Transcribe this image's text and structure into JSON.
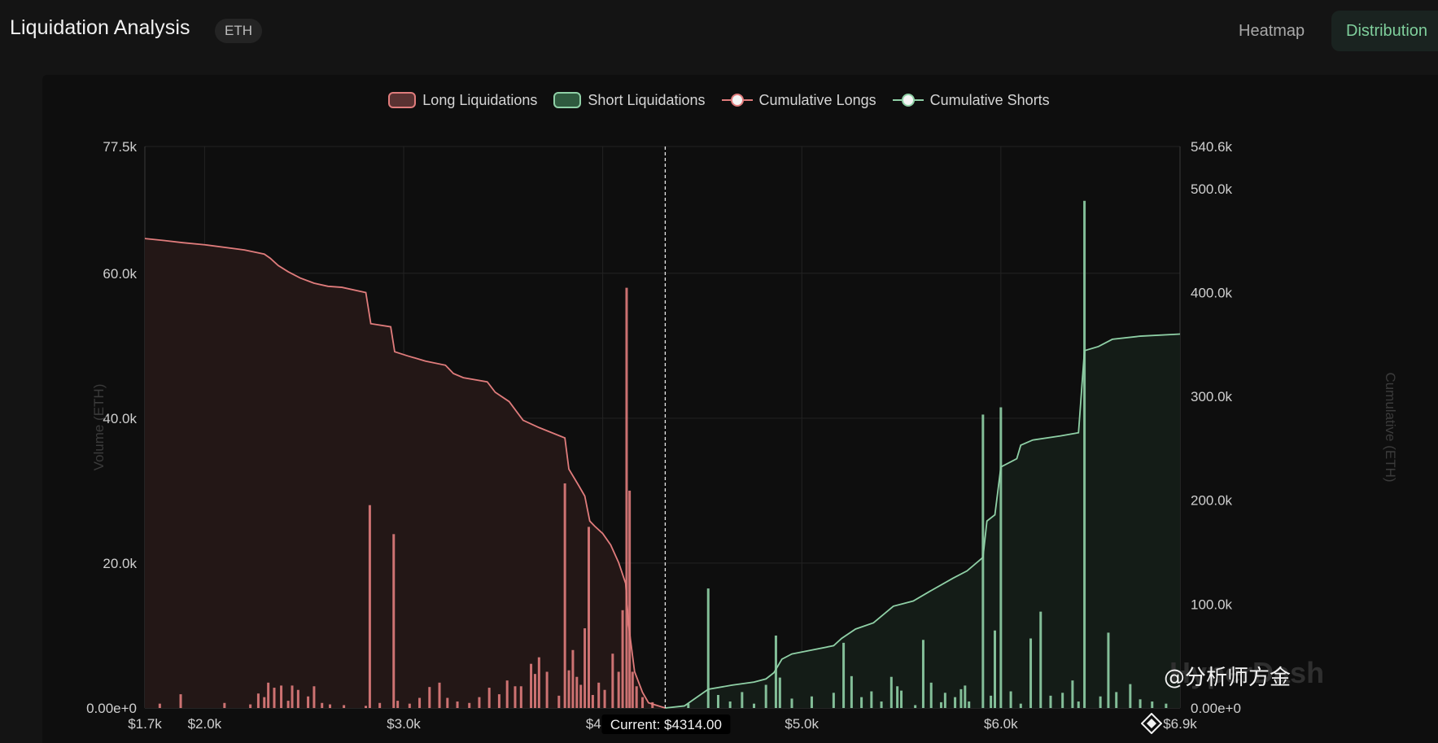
{
  "header": {
    "title": "Liquidation Analysis",
    "asset_badge": "ETH",
    "tabs": [
      {
        "label": "Heatmap",
        "active": false
      },
      {
        "label": "Distribution",
        "active": true
      }
    ]
  },
  "legend": {
    "long_liquidations": "Long Liquidations",
    "short_liquidations": "Short Liquidations",
    "cumulative_longs": "Cumulative Longs",
    "cumulative_shorts": "Cumulative Shorts"
  },
  "colors": {
    "long": "#e07c7c",
    "short": "#8fd0a6",
    "long_fill": "#231716",
    "short_fill": "#141c17",
    "accent": "#7fcf9c"
  },
  "current_price_label": "Current: $4314.00",
  "watermark": "HyperDash",
  "overlay_caption": "@分析师方金",
  "chart_data": {
    "type": "bar",
    "xlabel": "",
    "ylabel": "Volume (ETH)",
    "y2label": "Cumulative (ETH)",
    "xlim": [
      1700,
      6900
    ],
    "ylim": [
      0,
      77500
    ],
    "y2lim": [
      0,
      540600
    ],
    "current_price": 4314,
    "x_tick_labels": [
      {
        "x": 1700,
        "label": "$1.7k"
      },
      {
        "x": 2000,
        "label": "$2.0k"
      },
      {
        "x": 3000,
        "label": "$3.0k"
      },
      {
        "x": 4000,
        "label": "$4.0k"
      },
      {
        "x": 5000,
        "label": "$5.0k"
      },
      {
        "x": 6000,
        "label": "$6.0k"
      },
      {
        "x": 6900,
        "label": "$6.9k"
      }
    ],
    "y_tick_labels": [
      {
        "y": 0,
        "label": "0.00e+0"
      },
      {
        "y": 20000,
        "label": "20.0k"
      },
      {
        "y": 40000,
        "label": "40.0k"
      },
      {
        "y": 60000,
        "label": "60.0k"
      },
      {
        "y": 77500,
        "label": "77.5k"
      }
    ],
    "y2_tick_labels": [
      {
        "y": 0,
        "label": "0.00e+0"
      },
      {
        "y": 100000,
        "label": "100.0k"
      },
      {
        "y": 200000,
        "label": "200.0k"
      },
      {
        "y": 300000,
        "label": "300.0k"
      },
      {
        "y": 400000,
        "label": "400.0k"
      },
      {
        "y": 500000,
        "label": "500.0k"
      },
      {
        "y": 540600,
        "label": "540.6k"
      }
    ],
    "series": [
      {
        "name": "Long Liquidations",
        "kind": "bars",
        "points": [
          [
            1775,
            600
          ],
          [
            1880,
            1900
          ],
          [
            2100,
            700
          ],
          [
            2230,
            500
          ],
          [
            2270,
            2000
          ],
          [
            2300,
            1500
          ],
          [
            2320,
            3500
          ],
          [
            2350,
            2800
          ],
          [
            2385,
            3100
          ],
          [
            2420,
            1000
          ],
          [
            2440,
            3100
          ],
          [
            2470,
            2500
          ],
          [
            2520,
            1600
          ],
          [
            2550,
            3000
          ],
          [
            2590,
            700
          ],
          [
            2630,
            500
          ],
          [
            2700,
            400
          ],
          [
            2810,
            300
          ],
          [
            2830,
            28000
          ],
          [
            2880,
            700
          ],
          [
            2950,
            24000
          ],
          [
            2970,
            1000
          ],
          [
            3030,
            600
          ],
          [
            3080,
            1400
          ],
          [
            3130,
            2900
          ],
          [
            3180,
            3500
          ],
          [
            3220,
            1400
          ],
          [
            3270,
            900
          ],
          [
            3330,
            700
          ],
          [
            3380,
            1500
          ],
          [
            3430,
            2800
          ],
          [
            3480,
            1900
          ],
          [
            3520,
            3800
          ],
          [
            3560,
            3000
          ],
          [
            3590,
            3000
          ],
          [
            3640,
            6100
          ],
          [
            3660,
            4700
          ],
          [
            3680,
            7000
          ],
          [
            3720,
            5000
          ],
          [
            3780,
            1700
          ],
          [
            3810,
            31000
          ],
          [
            3830,
            5200
          ],
          [
            3850,
            8000
          ],
          [
            3870,
            4300
          ],
          [
            3890,
            3200
          ],
          [
            3910,
            11000
          ],
          [
            3930,
            25000
          ],
          [
            3950,
            1800
          ],
          [
            3980,
            3500
          ],
          [
            4010,
            2500
          ],
          [
            4050,
            7500
          ],
          [
            4080,
            5000
          ],
          [
            4100,
            13500
          ],
          [
            4120,
            58000
          ],
          [
            4135,
            30000
          ],
          [
            4150,
            5000
          ],
          [
            4170,
            3000
          ],
          [
            4200,
            1500
          ],
          [
            4250,
            800
          ]
        ]
      },
      {
        "name": "Short Liquidations",
        "kind": "bars",
        "points": [
          [
            4430,
            600
          ],
          [
            4530,
            16500
          ],
          [
            4580,
            1800
          ],
          [
            4640,
            900
          ],
          [
            4700,
            2200
          ],
          [
            4760,
            600
          ],
          [
            4820,
            3200
          ],
          [
            4870,
            10000
          ],
          [
            4890,
            4200
          ],
          [
            4950,
            1300
          ],
          [
            5050,
            1600
          ],
          [
            5160,
            2100
          ],
          [
            5210,
            9000
          ],
          [
            5250,
            4400
          ],
          [
            5300,
            1500
          ],
          [
            5350,
            2300
          ],
          [
            5400,
            900
          ],
          [
            5450,
            4300
          ],
          [
            5480,
            3000
          ],
          [
            5500,
            2400
          ],
          [
            5570,
            400
          ],
          [
            5610,
            9400
          ],
          [
            5650,
            3500
          ],
          [
            5700,
            800
          ],
          [
            5720,
            2100
          ],
          [
            5770,
            1500
          ],
          [
            5800,
            2600
          ],
          [
            5820,
            3100
          ],
          [
            5840,
            900
          ],
          [
            5910,
            40500
          ],
          [
            5950,
            1700
          ],
          [
            5970,
            10700
          ],
          [
            6000,
            41500
          ],
          [
            6050,
            2300
          ],
          [
            6100,
            600
          ],
          [
            6150,
            9600
          ],
          [
            6200,
            13300
          ],
          [
            6250,
            1700
          ],
          [
            6310,
            2100
          ],
          [
            6360,
            3800
          ],
          [
            6390,
            900
          ],
          [
            6420,
            70000
          ],
          [
            6500,
            1600
          ],
          [
            6540,
            10400
          ],
          [
            6580,
            2200
          ],
          [
            6650,
            3300
          ],
          [
            6700,
            1200
          ],
          [
            6760,
            900
          ],
          [
            6830,
            600
          ]
        ]
      },
      {
        "name": "Cumulative Longs",
        "kind": "cumulative",
        "points": [
          [
            1700,
            452000
          ],
          [
            1800,
            450000
          ],
          [
            1890,
            448000
          ],
          [
            2000,
            446000
          ],
          [
            2200,
            441000
          ],
          [
            2300,
            437000
          ],
          [
            2330,
            433000
          ],
          [
            2370,
            426000
          ],
          [
            2420,
            420000
          ],
          [
            2480,
            414000
          ],
          [
            2550,
            409000
          ],
          [
            2620,
            406000
          ],
          [
            2690,
            405000
          ],
          [
            2810,
            400000
          ],
          [
            2835,
            370000
          ],
          [
            2935,
            367000
          ],
          [
            2955,
            343000
          ],
          [
            3020,
            339000
          ],
          [
            3110,
            334000
          ],
          [
            3210,
            330000
          ],
          [
            3250,
            322000
          ],
          [
            3300,
            318000
          ],
          [
            3420,
            314000
          ],
          [
            3460,
            304000
          ],
          [
            3530,
            295000
          ],
          [
            3600,
            277000
          ],
          [
            3680,
            270000
          ],
          [
            3810,
            260000
          ],
          [
            3830,
            230000
          ],
          [
            3880,
            214000
          ],
          [
            3910,
            204000
          ],
          [
            3935,
            180000
          ],
          [
            3960,
            175000
          ],
          [
            4000,
            168000
          ],
          [
            4040,
            157000
          ],
          [
            4080,
            140000
          ],
          [
            4115,
            120000
          ],
          [
            4130,
            80000
          ],
          [
            4160,
            35000
          ],
          [
            4200,
            15000
          ],
          [
            4230,
            5000
          ],
          [
            4314,
            0
          ]
        ]
      },
      {
        "name": "Cumulative Shorts",
        "kind": "cumulative",
        "points": [
          [
            4314,
            0
          ],
          [
            4410,
            2000
          ],
          [
            4530,
            18000
          ],
          [
            4650,
            22000
          ],
          [
            4760,
            25000
          ],
          [
            4820,
            28000
          ],
          [
            4860,
            34000
          ],
          [
            4900,
            47000
          ],
          [
            4950,
            52000
          ],
          [
            5030,
            55000
          ],
          [
            5160,
            60000
          ],
          [
            5200,
            67000
          ],
          [
            5270,
            76000
          ],
          [
            5360,
            82000
          ],
          [
            5460,
            98000
          ],
          [
            5560,
            103000
          ],
          [
            5640,
            112000
          ],
          [
            5760,
            125000
          ],
          [
            5830,
            132000
          ],
          [
            5910,
            145000
          ],
          [
            5930,
            180000
          ],
          [
            5970,
            186000
          ],
          [
            6000,
            232000
          ],
          [
            6080,
            240000
          ],
          [
            6100,
            253000
          ],
          [
            6160,
            258000
          ],
          [
            6300,
            262000
          ],
          [
            6390,
            265000
          ],
          [
            6420,
            344000
          ],
          [
            6490,
            348000
          ],
          [
            6560,
            355000
          ],
          [
            6700,
            358000
          ],
          [
            6900,
            360000
          ]
        ]
      }
    ]
  }
}
